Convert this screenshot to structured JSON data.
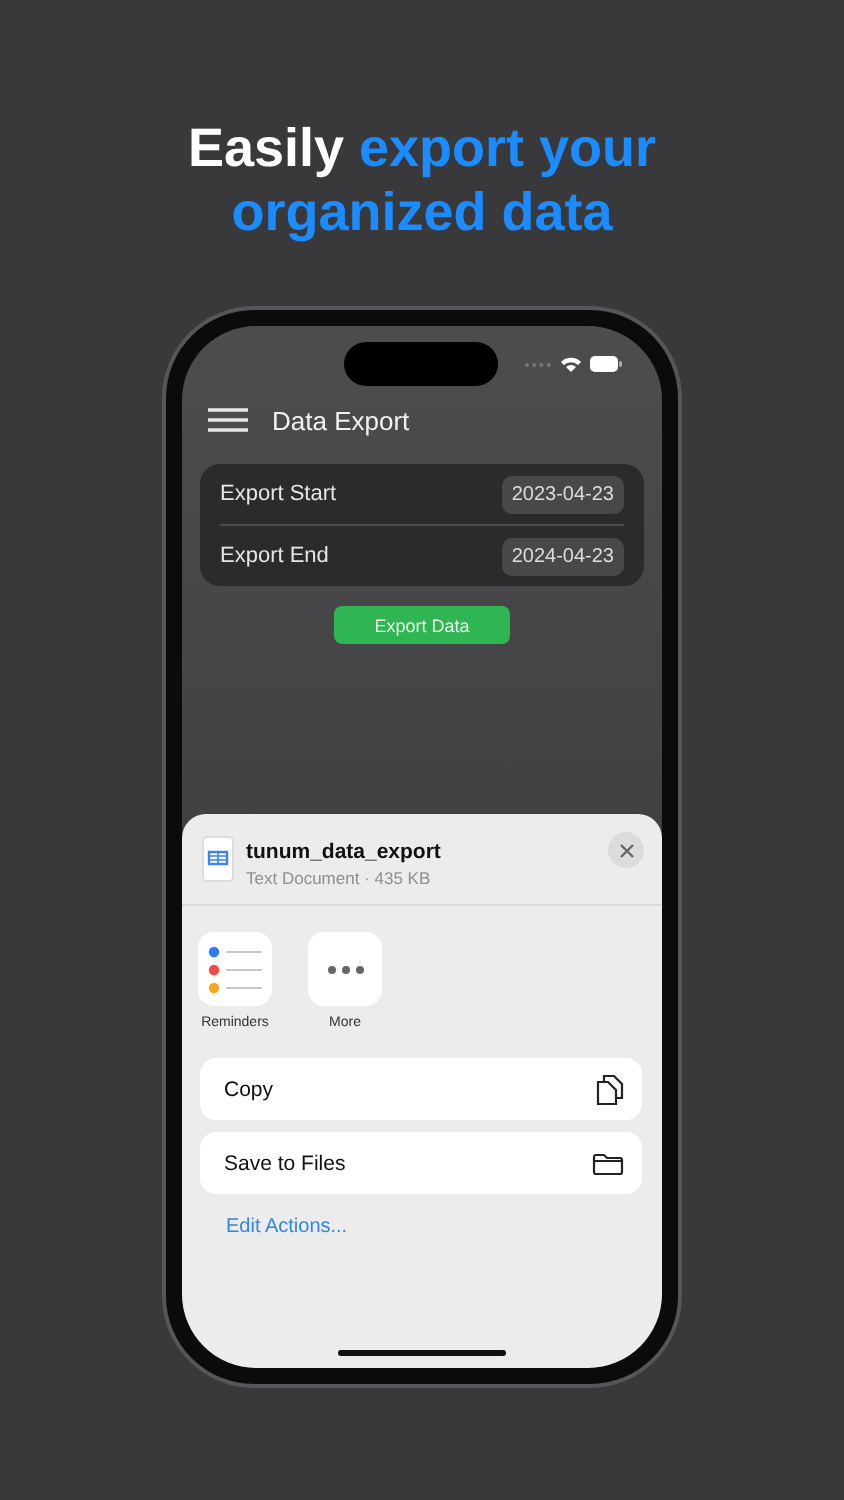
{
  "headline": [
    {
      "text": "Easily",
      "accent": false
    },
    {
      "text": "export your organized data",
      "accent": true
    }
  ],
  "screen": {
    "title": "Data Export",
    "fields": [
      {
        "label": "Export Start",
        "value": "2023-04-23"
      },
      {
        "label": "Export End",
        "value": "2024-04-23"
      }
    ],
    "button": "Export Data"
  },
  "share_sheet": {
    "file_name": "tunum_data_export",
    "file_info": "Text Document · 435 KB",
    "apps": [
      {
        "label": "Reminders",
        "kind": "reminders"
      },
      {
        "label": "More",
        "kind": "more"
      }
    ],
    "actions": [
      {
        "label": "Copy",
        "kind": "copy"
      },
      {
        "label": "Save to Files",
        "kind": "folder"
      }
    ],
    "edit_link": "Edit Actions..."
  }
}
